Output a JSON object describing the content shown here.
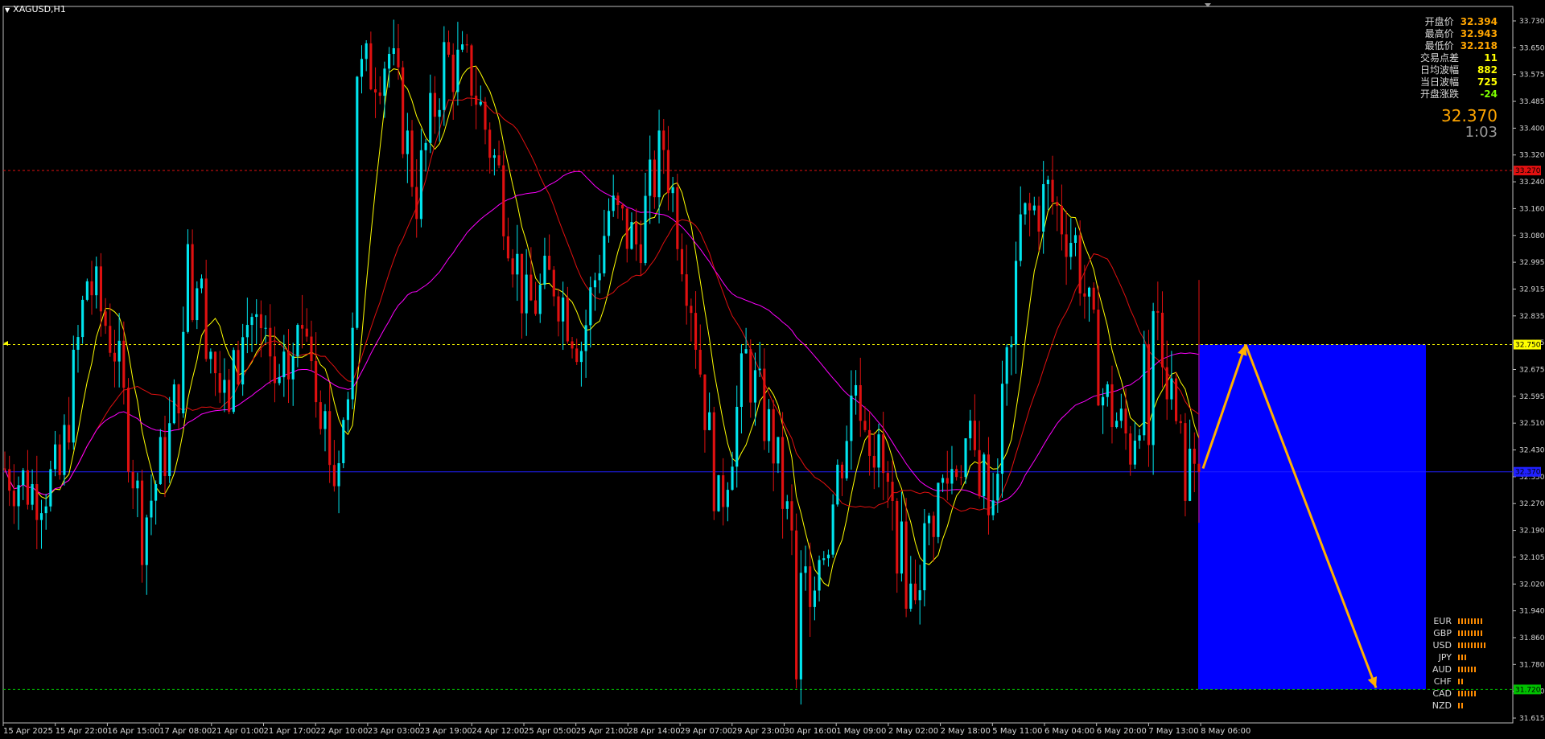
{
  "window": {
    "title": "XAGUSD,H1"
  },
  "info_panel": [
    {
      "label": "开盘价",
      "value": "32.394",
      "color": "#ffa500"
    },
    {
      "label": "最高价",
      "value": "32.943",
      "color": "#ffa500"
    },
    {
      "label": "最低价",
      "value": "32.218",
      "color": "#ffa500"
    },
    {
      "label": "交易点差",
      "value": "11",
      "color": "#ffff00"
    },
    {
      "label": "日均波幅",
      "value": "882",
      "color": "#ffff00"
    },
    {
      "label": "当日波幅",
      "value": "725",
      "color": "#ffff00"
    },
    {
      "label": "开盘涨跌",
      "value": "-24",
      "color": "#7cfc00"
    }
  ],
  "current_price": "32.370",
  "bar_timer": "1:03",
  "currency_strength": [
    {
      "currency": "EUR",
      "level": 8
    },
    {
      "currency": "GBP",
      "level": 8
    },
    {
      "currency": "USD",
      "level": 9
    },
    {
      "currency": "JPY",
      "level": 3
    },
    {
      "currency": "AUD",
      "level": 6
    },
    {
      "currency": "CHF",
      "level": 2
    },
    {
      "currency": "CAD",
      "level": 6
    },
    {
      "currency": "NZD",
      "level": 2
    }
  ],
  "colors": {
    "background": "#000000",
    "bull_candle": "#00e5ee",
    "bear_candle": "#e01010",
    "ma_fast": "#ffff00",
    "ma_mid": "#e01010",
    "ma_slow": "#ff00ff",
    "target_box": "#0000ff",
    "arrow": "#ffb000",
    "strength_bar": "#ff8c00"
  },
  "chart_data": {
    "type": "candlestick",
    "symbol": "XAGUSD",
    "timeframe": "H1",
    "ylim": [
      31.615,
      33.75
    ],
    "y_ticks": [
      "33.730",
      "33.650",
      "33.575",
      "33.485",
      "33.400",
      "33.320",
      "33.240",
      "33.160",
      "33.080",
      "32.995",
      "32.915",
      "32.835",
      "32.755",
      "32.675",
      "32.595",
      "32.510",
      "32.430",
      "32.350",
      "32.270",
      "32.190",
      "32.105",
      "32.020",
      "31.940",
      "31.860",
      "31.780",
      "31.700",
      "31.615"
    ],
    "x_ticks": [
      "15 Apr 2025",
      "15 Apr 22:00",
      "16 Apr 15:00",
      "17 Apr 08:00",
      "21 Apr 01:00",
      "21 Apr 17:00",
      "22 Apr 10:00",
      "23 Apr 03:00",
      "23 Apr 19:00",
      "24 Apr 12:00",
      "25 Apr 05:00",
      "25 Apr 21:00",
      "28 Apr 14:00",
      "29 Apr 07:00",
      "29 Apr 23:00",
      "30 Apr 16:00",
      "1 May 09:00",
      "2 May 02:00",
      "2 May 18:00",
      "5 May 11:00",
      "6 May 04:00",
      "6 May 20:00",
      "7 May 13:00",
      "8 May 06:00"
    ],
    "path_points": [
      [
        0,
        32.38
      ],
      [
        6,
        32.32
      ],
      [
        12,
        32.35
      ],
      [
        18,
        32.95
      ],
      [
        24,
        32.75
      ],
      [
        30,
        32.2
      ],
      [
        36,
        32.48
      ],
      [
        42,
        32.95
      ],
      [
        48,
        32.55
      ],
      [
        54,
        32.85
      ],
      [
        60,
        32.58
      ],
      [
        66,
        32.85
      ],
      [
        72,
        32.35
      ],
      [
        77,
        32.75
      ],
      [
        78,
        33.55
      ],
      [
        84,
        33.62
      ],
      [
        90,
        33.2
      ],
      [
        96,
        33.6
      ],
      [
        102,
        33.55
      ],
      [
        108,
        33.25
      ],
      [
        114,
        32.85
      ],
      [
        120,
        32.95
      ],
      [
        126,
        32.75
      ],
      [
        132,
        33.15
      ],
      [
        138,
        33.05
      ],
      [
        144,
        33.35
      ],
      [
        150,
        32.9
      ],
      [
        156,
        32.25
      ],
      [
        162,
        32.7
      ],
      [
        168,
        32.45
      ],
      [
        174,
        32.0
      ],
      [
        180,
        32.2
      ],
      [
        186,
        32.65
      ],
      [
        192,
        32.35
      ],
      [
        198,
        32.0
      ],
      [
        204,
        32.3
      ],
      [
        210,
        32.45
      ],
      [
        216,
        32.3
      ],
      [
        222,
        33.1
      ],
      [
        228,
        33.2
      ],
      [
        234,
        33.05
      ],
      [
        240,
        32.6
      ],
      [
        246,
        32.45
      ],
      [
        252,
        32.85
      ],
      [
        258,
        32.35
      ]
    ],
    "events": [
      {
        "x": 40,
        "close": 33.05
      },
      {
        "x": 76,
        "close": 32.8
      },
      {
        "x": 77,
        "close": 33.55
      },
      {
        "x": 173,
        "close": 31.75
      },
      {
        "x": 220,
        "close": 32.75
      },
      {
        "x": 221,
        "close": 33.0
      },
      {
        "x": 250,
        "close": 32.45
      },
      {
        "x": 251,
        "close": 32.85
      }
    ],
    "horizontal_lines": [
      {
        "price": 33.27,
        "label": "33.270",
        "style": "dotted",
        "color": "#e01010"
      },
      {
        "price": 32.75,
        "label": "32.750",
        "style": "dotted",
        "color": "#ffff00"
      },
      {
        "price": 32.37,
        "label": "32.370",
        "style": "solid",
        "color": "#2020ff"
      },
      {
        "price": 31.72,
        "label": "31.720",
        "style": "dotted",
        "color": "#00c000"
      }
    ],
    "target_box": {
      "price_top": 32.75,
      "price_bottom": 31.72
    },
    "arrows": [
      {
        "from_price": 32.38,
        "to_price": 32.75
      },
      {
        "from_price": 32.75,
        "to_price": 31.72
      }
    ]
  }
}
